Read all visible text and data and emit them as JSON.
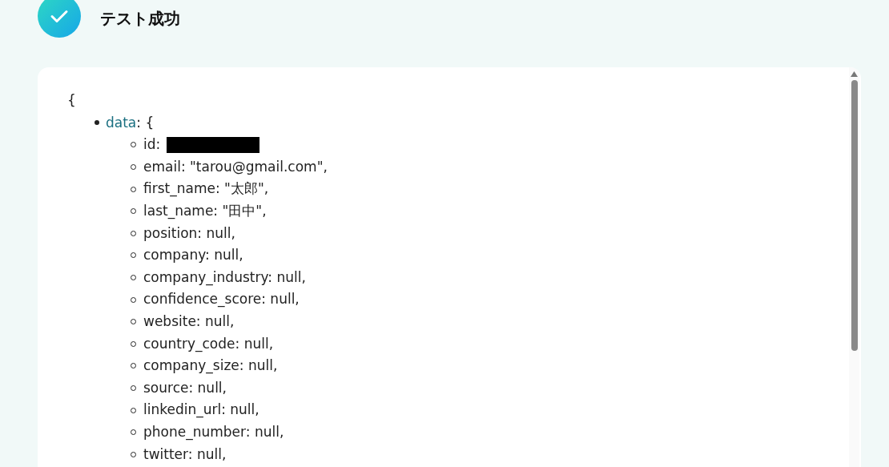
{
  "header": {
    "title": "テスト成功"
  },
  "output": {
    "open_brace": "{",
    "entries": [
      {
        "key": "data",
        "suffix": ": {",
        "children": [
          {
            "text": "id:",
            "redacted": true
          },
          {
            "text": "email: \"tarou@gmail.com\","
          },
          {
            "text": "first_name: \"太郎\","
          },
          {
            "text": "last_name: \"田中\","
          },
          {
            "text": "position: null,"
          },
          {
            "text": "company: null,"
          },
          {
            "text": "company_industry: null,"
          },
          {
            "text": "confidence_score: null,"
          },
          {
            "text": "website: null,"
          },
          {
            "text": "country_code: null,"
          },
          {
            "text": "company_size: null,"
          },
          {
            "text": "source: null,"
          },
          {
            "text": "linkedin_url: null,"
          },
          {
            "text": "phone_number: null,"
          },
          {
            "text": "twitter: null,"
          }
        ]
      }
    ]
  }
}
